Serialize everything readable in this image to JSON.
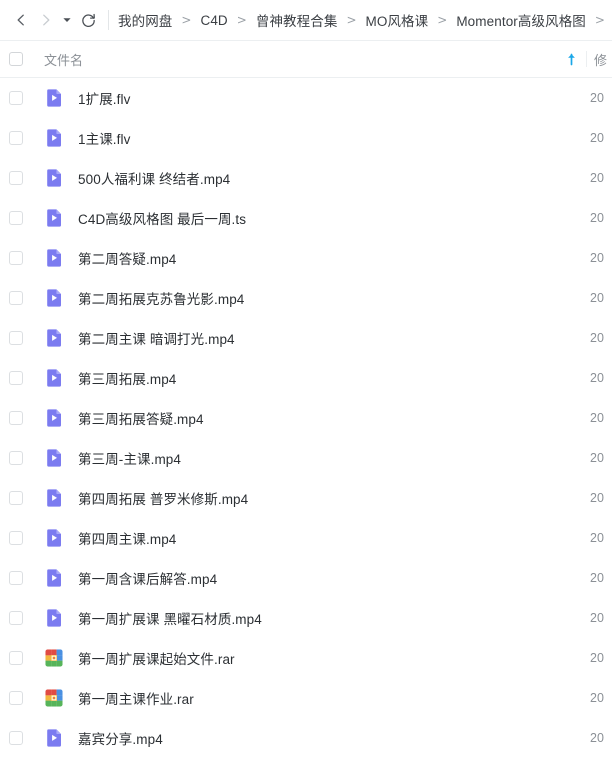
{
  "toolbar": {
    "back_label": "后退",
    "forward_label": "前进",
    "history_label": "历史记录",
    "refresh_label": "刷新",
    "breadcrumb": [
      "我的网盘",
      "C4D",
      "曾神教程合集",
      "MO风格课",
      "Momentor高级风格图"
    ],
    "breadcrumb_separator": ">",
    "trailing_separator": ">"
  },
  "columns": {
    "name": "文件名",
    "mtime": "修",
    "sort_direction": "ascending"
  },
  "colors": {
    "video_icon": "#7b7bf0",
    "video_icon_dark": "#6d6de8",
    "sort_arrow": "#1aa7e8",
    "text": "#2b2f33",
    "muted": "#8b9096",
    "border": "#eceff1"
  },
  "files": [
    {
      "name": "1扩展.flv",
      "type": "video",
      "icon": "video-file-icon",
      "mtime": "20"
    },
    {
      "name": "1主课.flv",
      "type": "video",
      "icon": "video-file-icon",
      "mtime": "20"
    },
    {
      "name": "500人福利课 终结者.mp4",
      "type": "video",
      "icon": "video-file-icon",
      "mtime": "20"
    },
    {
      "name": "C4D高级风格图 最后一周.ts",
      "type": "video",
      "icon": "video-file-icon",
      "mtime": "20"
    },
    {
      "name": "第二周答疑.mp4",
      "type": "video",
      "icon": "video-file-icon",
      "mtime": "20"
    },
    {
      "name": "第二周拓展克苏鲁光影.mp4",
      "type": "video",
      "icon": "video-file-icon",
      "mtime": "20"
    },
    {
      "name": "第二周主课 暗调打光.mp4",
      "type": "video",
      "icon": "video-file-icon",
      "mtime": "20"
    },
    {
      "name": "第三周拓展.mp4",
      "type": "video",
      "icon": "video-file-icon",
      "mtime": "20"
    },
    {
      "name": "第三周拓展答疑.mp4",
      "type": "video",
      "icon": "video-file-icon",
      "mtime": "20"
    },
    {
      "name": "第三周-主课.mp4",
      "type": "video",
      "icon": "video-file-icon",
      "mtime": "20"
    },
    {
      "name": "第四周拓展 普罗米修斯.mp4",
      "type": "video",
      "icon": "video-file-icon",
      "mtime": "20"
    },
    {
      "name": "第四周主课.mp4",
      "type": "video",
      "icon": "video-file-icon",
      "mtime": "20"
    },
    {
      "name": "第一周含课后解答.mp4",
      "type": "video",
      "icon": "video-file-icon",
      "mtime": "20"
    },
    {
      "name": "第一周扩展课 黑曜石材质.mp4",
      "type": "video",
      "icon": "video-file-icon",
      "mtime": "20"
    },
    {
      "name": "第一周扩展课起始文件.rar",
      "type": "archive",
      "icon": "rar-archive-icon",
      "mtime": "20"
    },
    {
      "name": "第一周主课作业.rar",
      "type": "archive",
      "icon": "rar-archive-icon",
      "mtime": "20"
    },
    {
      "name": "嘉宾分享.mp4",
      "type": "video",
      "icon": "video-file-icon",
      "mtime": "20"
    }
  ]
}
